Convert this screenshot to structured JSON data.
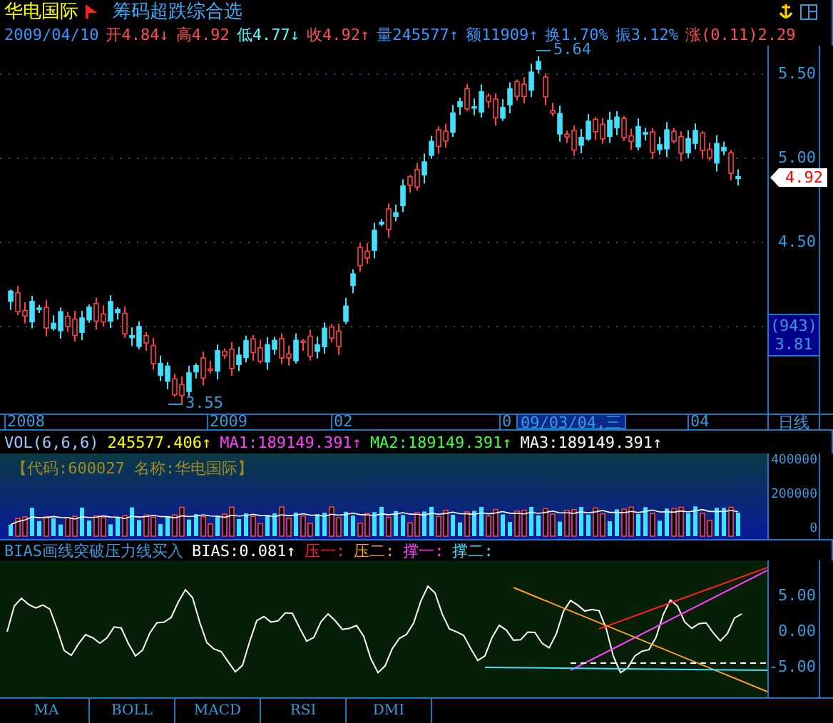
{
  "stock": {
    "name": "华电国际",
    "formula": "筹码超跌综合选"
  },
  "quote": {
    "date": "2009/04/10",
    "items": [
      {
        "text": "开4.84",
        "arrow": "↓",
        "color": "#ff5050"
      },
      {
        "text": "高4.92",
        "color": "#ff5050"
      },
      {
        "text": "低4.77",
        "arrow": "↓",
        "color": "#55ffff"
      },
      {
        "text": "收4.92",
        "arrow": "↑",
        "color": "#ff5050"
      },
      {
        "text": "量245577",
        "arrow": "↑",
        "color": "#3399ff"
      },
      {
        "text": "额11909",
        "arrow": "↑",
        "color": "#3399ff"
      },
      {
        "text": "换1.70%",
        "color": "#3399ff"
      },
      {
        "text": "振3.12%",
        "color": "#3399ff"
      },
      {
        "text": "涨(0.11)2.29",
        "color": "#ff5050"
      }
    ]
  },
  "price_chart": {
    "high_label": "5.64",
    "low_label": "3.55",
    "axis_ticks": [
      "5.50",
      "5.00",
      "4.50"
    ],
    "last_price": "4.92",
    "cost_count": "(943)",
    "cost_price": "3.81"
  },
  "time_axis": {
    "labels": [
      "2008",
      "2009",
      "02",
      "0",
      "04"
    ],
    "cursor_date": "09/03/04,三",
    "period": "日线"
  },
  "volume": {
    "items": [
      {
        "text": "VOL(6,6,6)",
        "color": "#9fc8ff"
      },
      {
        "text": "245577.406",
        "arrow": "↑",
        "color": "#ffff00"
      },
      {
        "text": "MA1:189149.391",
        "arrow": "↑",
        "color": "#ff40ff"
      },
      {
        "text": "MA2:189149.391",
        "arrow": "↑",
        "color": "#40ff40"
      },
      {
        "text": "MA3:189149.391",
        "arrow": "↑",
        "color": "#ffffff"
      }
    ],
    "info": "【代码:600027 名称:华电国际】",
    "axis_ticks": [
      "400000",
      "200000",
      "0"
    ]
  },
  "bias": {
    "title": "BIAS画线突破压力线买入",
    "items": [
      {
        "text": "BIAS:0.081",
        "arrow": "↑"
      },
      {
        "text": "压一:",
        "color": "#ff2020"
      },
      {
        "text": "压二:",
        "color": "#ffa020"
      },
      {
        "text": "撑一:",
        "color": "#ff40ff"
      },
      {
        "text": "撑二:",
        "color": "#40e0ff"
      }
    ],
    "axis_ticks": [
      "5.00",
      "0.00",
      "-5.00"
    ]
  },
  "tabs": [
    {
      "label": "MA",
      "selected": false
    },
    {
      "label": "BOLL",
      "selected": false
    },
    {
      "label": "MACD",
      "selected": false
    },
    {
      "label": "RSI",
      "selected": false
    },
    {
      "label": "DMI",
      "selected": false
    }
  ]
}
